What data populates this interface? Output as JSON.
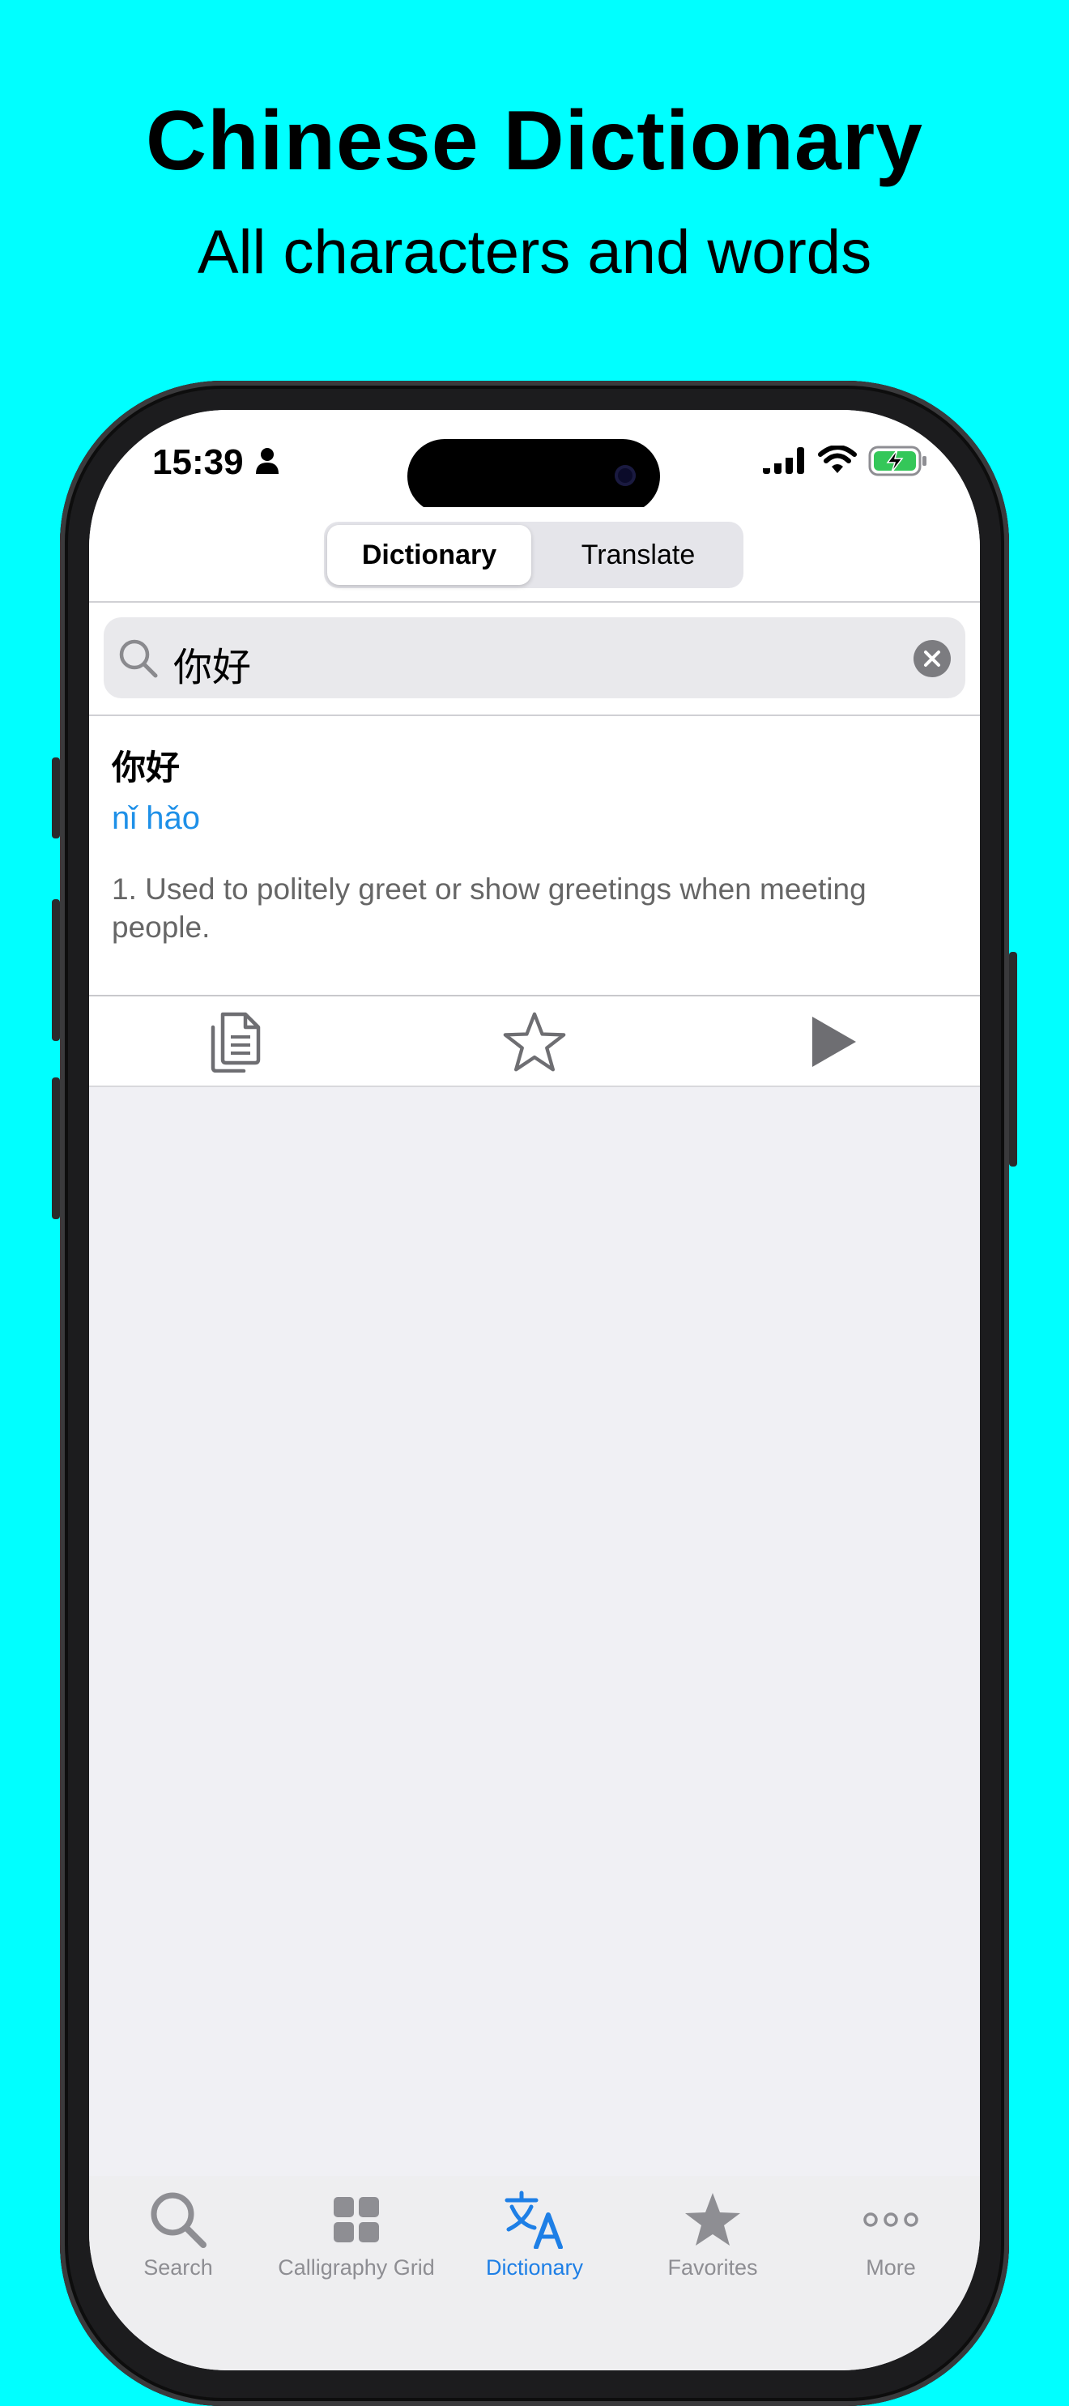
{
  "promo": {
    "title": "Chinese Dictionary",
    "subtitle": "All characters and words"
  },
  "status_bar": {
    "time": "15:39"
  },
  "segmented_control": {
    "options": [
      "Dictionary",
      "Translate"
    ],
    "selected": "Dictionary"
  },
  "search": {
    "value": "你好"
  },
  "entry": {
    "hanzi": "你好",
    "pinyin": "nǐ hǎo",
    "definition": "1. Used to politely greet or show greetings when meeting people."
  },
  "actions": {
    "icons": [
      "copy-icon",
      "star-outline-icon",
      "play-icon"
    ]
  },
  "tab_bar": {
    "tabs": [
      {
        "label": "Search",
        "icon": "search-icon"
      },
      {
        "label": "Calligraphy Grid",
        "icon": "grid-icon"
      },
      {
        "label": "Dictionary",
        "icon": "translate-icon"
      },
      {
        "label": "Favorites",
        "icon": "star-icon"
      },
      {
        "label": "More",
        "icon": "more-icon"
      }
    ],
    "active_tab": "Dictionary"
  },
  "colors": {
    "background": "#00FFFF",
    "accent": "#1E7FE6",
    "pinyin": "#1E90E8",
    "inactive_tab": "#8e8e93"
  }
}
